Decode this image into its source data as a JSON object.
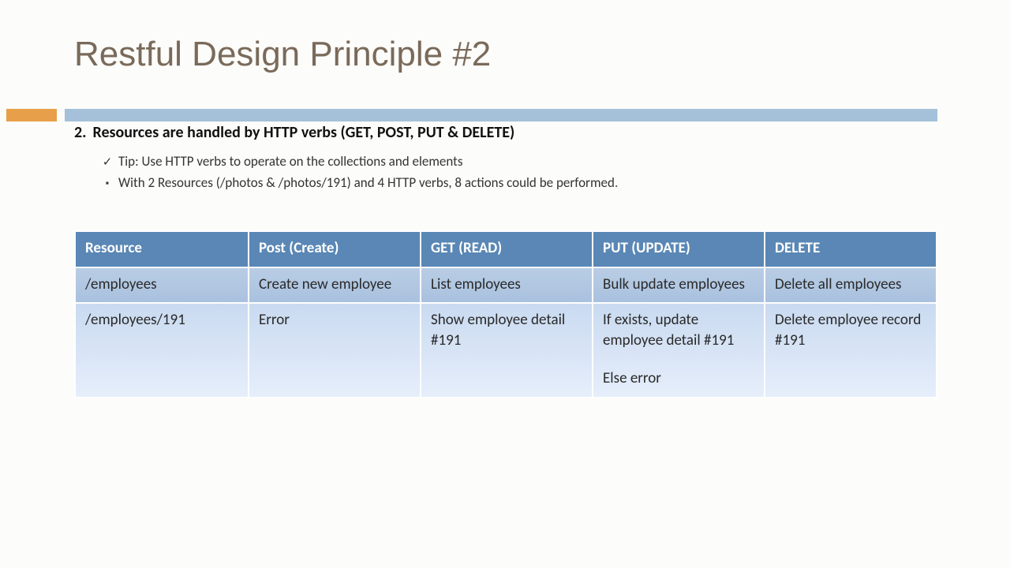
{
  "title": "Restful Design Principle #2",
  "principle": {
    "number": "2.",
    "text": "Resources are handled by HTTP verbs (GET, POST, PUT & DELETE)"
  },
  "bullets": [
    {
      "marker": "check",
      "text": "Tip: Use HTTP verbs to operate on the collections and elements"
    },
    {
      "marker": "square",
      "text": "With 2 Resources (/photos & /photos/191) and 4 HTTP verbs, 8 actions could be performed",
      "trailingDot": "."
    }
  ],
  "table": {
    "headers": [
      "Resource",
      "Post (Create)",
      "GET (READ)",
      "PUT (UPDATE)",
      "DELETE"
    ],
    "rows": [
      {
        "cells": [
          "/employees",
          "Create new employee",
          "List employees",
          "Bulk update employees",
          "Delete all employees"
        ]
      },
      {
        "cells": [
          "/employees/191",
          "Error",
          "Show employee detail #191",
          "If exists, update employee detail #191",
          "Delete employee record #191"
        ],
        "extra": {
          "col": 3,
          "text": "Else error"
        }
      }
    ]
  }
}
